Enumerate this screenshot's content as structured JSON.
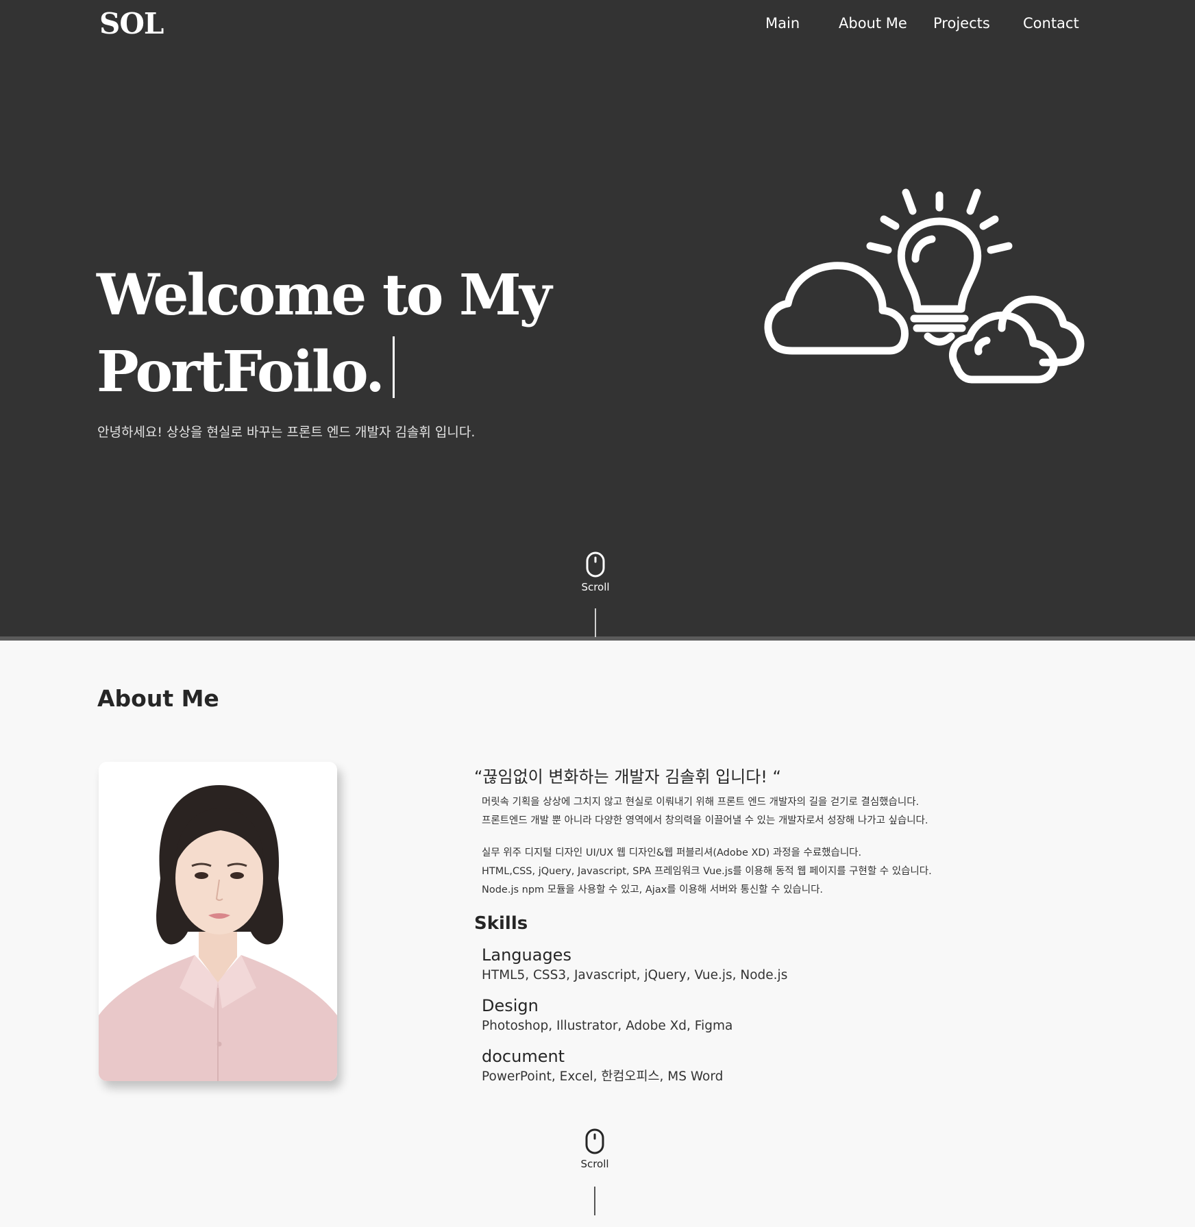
{
  "header": {
    "logo": "SOL",
    "nav": [
      "Main",
      "About Me",
      "Projects",
      "Contact"
    ]
  },
  "hero": {
    "title_line_1": "Welcome to My",
    "title_line_2": "PortFoilo.",
    "subtitle": "안녕하세요! 상상을 현실로 바꾸는 프론트 엔드 개발자 김솔휘 입니다.",
    "illustration_icon": "lightbulb-clouds-icon",
    "scroll_label": "Scroll"
  },
  "about": {
    "title": "About Me",
    "photo_icon": "profile-photo",
    "quote": "“끊임없이 변화하는 개발자 김솔휘 입니다! “",
    "paragraph_1": [
      "머릿속 기획을 상상에 그치지 않고 현실로 이뤄내기 위해 프론트 엔드 개발자의 길을 걷기로 결심했습니다.",
      "프론트엔드 개발 뿐 아니라 다양한 영역에서 창의력을 이끌어낼 수 있는 개발자로서 성장해 나가고 싶습니다."
    ],
    "paragraph_2": [
      "실무 위주 디지털 디자인 UI/UX 웹 디자인&웹 퍼블리셔(Adobe XD) 과정을 수료했습니다.",
      "HTML,CSS, jQuery, Javascript, SPA 프레임워크 Vue.js를 이용해 동적 웹 페이지를 구현할 수 있습니다.",
      "Node.js npm 모듈을 사용할 수 있고, Ajax를 이용해 서버와 통신할 수 있습니다."
    ],
    "skills_title": "Skills",
    "skills": [
      {
        "name": "Languages",
        "list": "HTML5, CSS3, Javascript, jQuery, Vue.js, Node.js"
      },
      {
        "name": "Design",
        "list": "Photoshop, Illustrator, Adobe Xd, Figma"
      },
      {
        "name": "document",
        "list": "PowerPoint, Excel, 한컴오피스, MS Word"
      }
    ],
    "scroll_label": "Scroll"
  },
  "colors": {
    "hero_background": "#333333",
    "page_background": "#f8f8f8",
    "text_dark": "#262626",
    "text_light": "#ffffff"
  }
}
